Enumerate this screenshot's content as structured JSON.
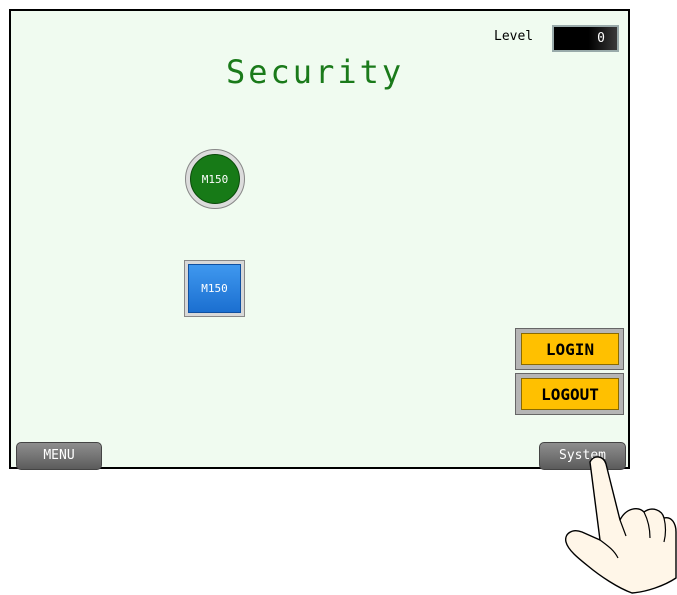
{
  "screen": {
    "title": "Security",
    "level_label": "Level",
    "level_value": "0"
  },
  "lamp": {
    "label": "M150",
    "color": "#177a17"
  },
  "switch": {
    "label": "M150",
    "color": "#2a86e6"
  },
  "buttons": {
    "login": "LOGIN",
    "logout": "LOGOUT",
    "menu": "MENU",
    "system": "System"
  },
  "colors": {
    "screen_bg": "#f0fbf0",
    "title": "#1a7a1a",
    "accent_orange": "#ffc000",
    "nav_gray": "#6e6e6e"
  },
  "icons": {
    "pointer": "hand-pointer-icon"
  }
}
